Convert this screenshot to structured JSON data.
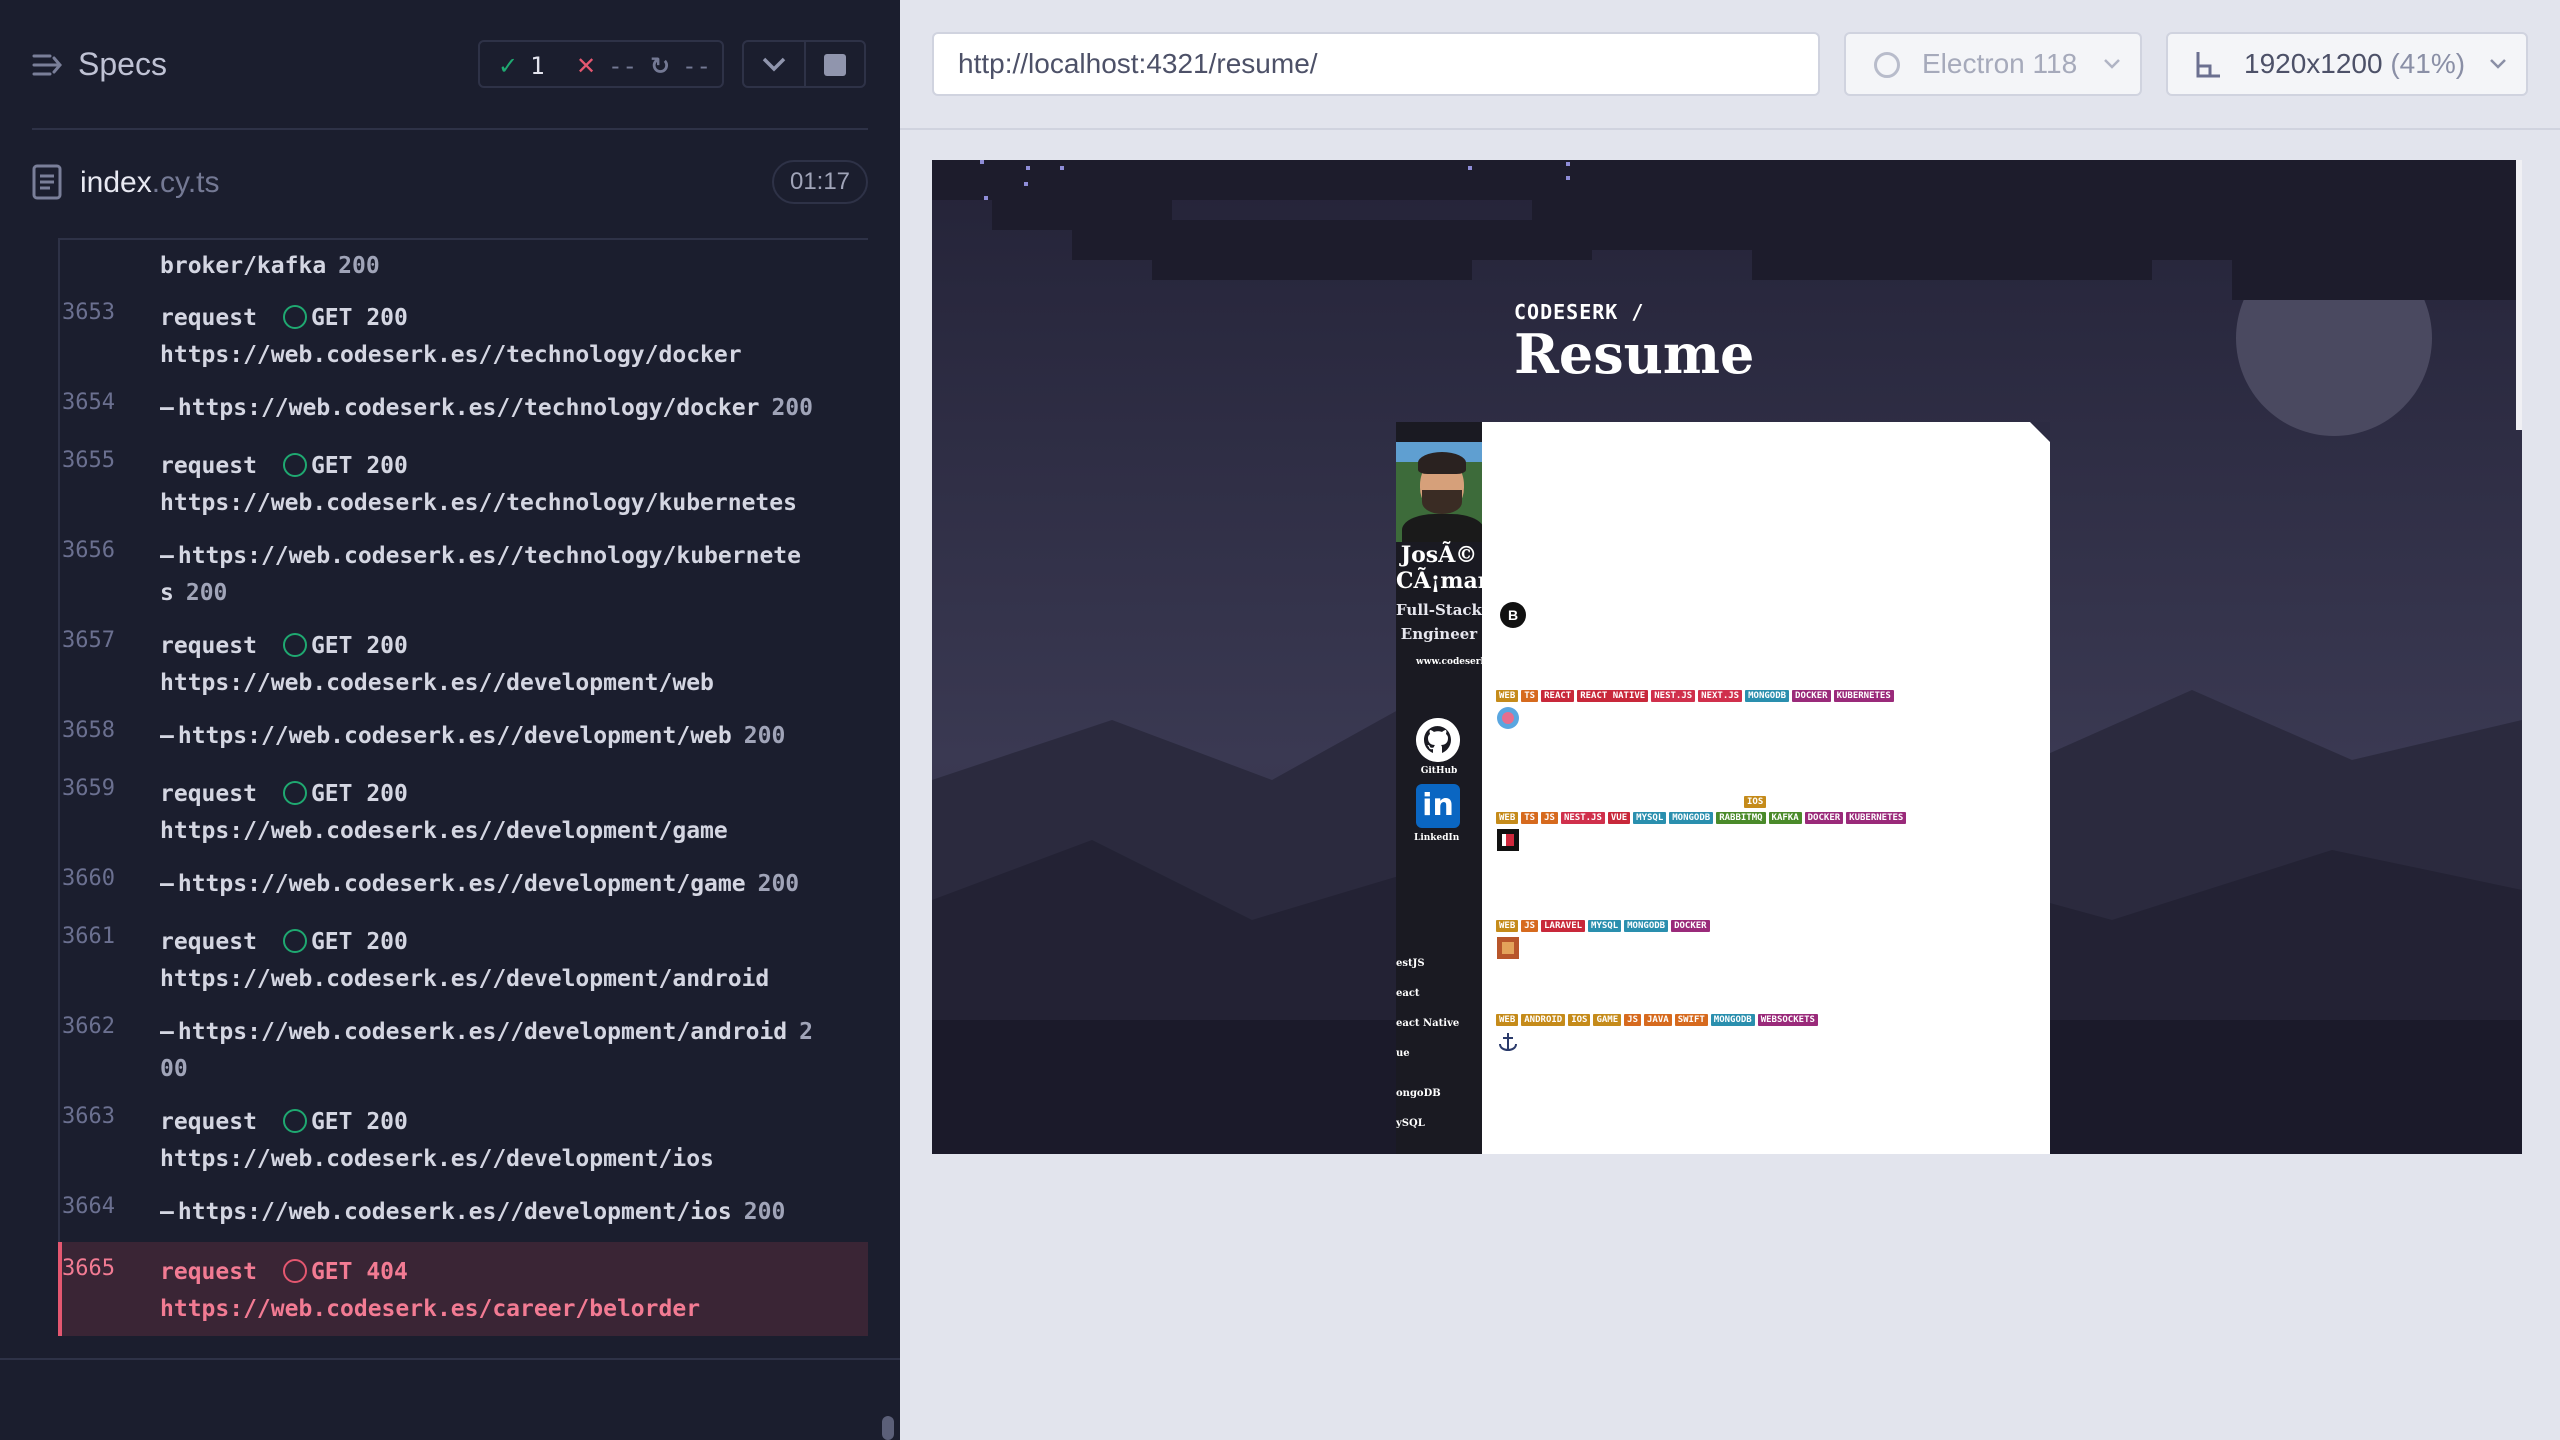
{
  "reporter": {
    "title": "Specs",
    "stats": {
      "passed": "1",
      "failed": "--",
      "pending": "--"
    },
    "file": {
      "name": "index",
      "ext": ".cy.ts"
    },
    "timer": "01:17",
    "log": [
      {
        "num": "",
        "kind": "continuation",
        "text": "broker/kafka",
        "status": "200"
      },
      {
        "num": "3653",
        "kind": "request",
        "label": "request",
        "method": "GET 200",
        "url": "https://web.codeserk.es//technology/docker"
      },
      {
        "num": "3654",
        "kind": "response",
        "text": "https://web.codeserk.es//technology/docker",
        "status": "200"
      },
      {
        "num": "3655",
        "kind": "request",
        "label": "request",
        "method": "GET 200",
        "url": "https://web.codeserk.es//technology/kubernetes"
      },
      {
        "num": "3656",
        "kind": "response",
        "text": "https://web.codeserk.es//technology/kubernete",
        "text2": "s",
        "status": "200"
      },
      {
        "num": "3657",
        "kind": "request",
        "label": "request",
        "method": "GET 200",
        "url": "https://web.codeserk.es//development/web"
      },
      {
        "num": "3658",
        "kind": "response",
        "text": "https://web.codeserk.es//development/web",
        "status": "200"
      },
      {
        "num": "3659",
        "kind": "request",
        "label": "request",
        "method": "GET 200",
        "url": "https://web.codeserk.es//development/game"
      },
      {
        "num": "3660",
        "kind": "response",
        "text": "https://web.codeserk.es//development/game",
        "status": "200"
      },
      {
        "num": "3661",
        "kind": "request",
        "label": "request",
        "method": "GET 200",
        "url": "https://web.codeserk.es//development/android"
      },
      {
        "num": "3662",
        "kind": "response",
        "text": "https://web.codeserk.es//development/android",
        "status": "2",
        "status2": "00"
      },
      {
        "num": "3663",
        "kind": "request",
        "label": "request",
        "method": "GET 200",
        "url": "https://web.codeserk.es//development/ios"
      },
      {
        "num": "3664",
        "kind": "response",
        "text": "https://web.codeserk.es//development/ios",
        "status": "200"
      },
      {
        "num": "3665",
        "kind": "failed",
        "label": "request",
        "method": "GET 404",
        "url": "https://web.codeserk.es/career/belorder"
      }
    ]
  },
  "aut": {
    "url": "http://localhost:4321/resume/",
    "browser": "Electron 118",
    "viewport": "1920x1200",
    "zoom": "(41%)"
  },
  "app": {
    "breadcrumb": "CODESERK /",
    "title": "Resume",
    "resume": {
      "name": "JosÃ© CÃ¡mara",
      "role": "Full-Stack Engineer",
      "site": "www.codeserk.es",
      "github_label": "GitHub",
      "linkedin_glyph": "in",
      "linkedin_label": "LinkedIn",
      "sidebar_skills": [
        "estJS",
        "eact",
        "eact Native",
        "ue",
        "ongoDB",
        "ySQL"
      ],
      "tag_rows": [
        [
          "WEB",
          "TS",
          "REACT",
          "REACT NATIVE",
          "NEST.JS",
          "NEXT.JS",
          "MONGODB",
          "DOCKER",
          "KUBERNETES"
        ],
        [
          "WEB",
          "TS",
          "JS",
          "NEST.JS",
          "VUE",
          "MYSQL",
          "MONGODB",
          "RABBITMQ",
          "KAFKA",
          "DOCKER",
          "KUBERNETES"
        ],
        [
          "WEB",
          "JS",
          "LARAVEL",
          "MYSQL",
          "MONGODB",
          "DOCKER"
        ],
        [
          "WEB",
          "ANDROID",
          "IOS",
          "GAME",
          "JS",
          "JAVA",
          "SWIFT",
          "MONGODB",
          "WEBSOCKETS"
        ]
      ],
      "ios_tag": "IOS"
    }
  }
}
